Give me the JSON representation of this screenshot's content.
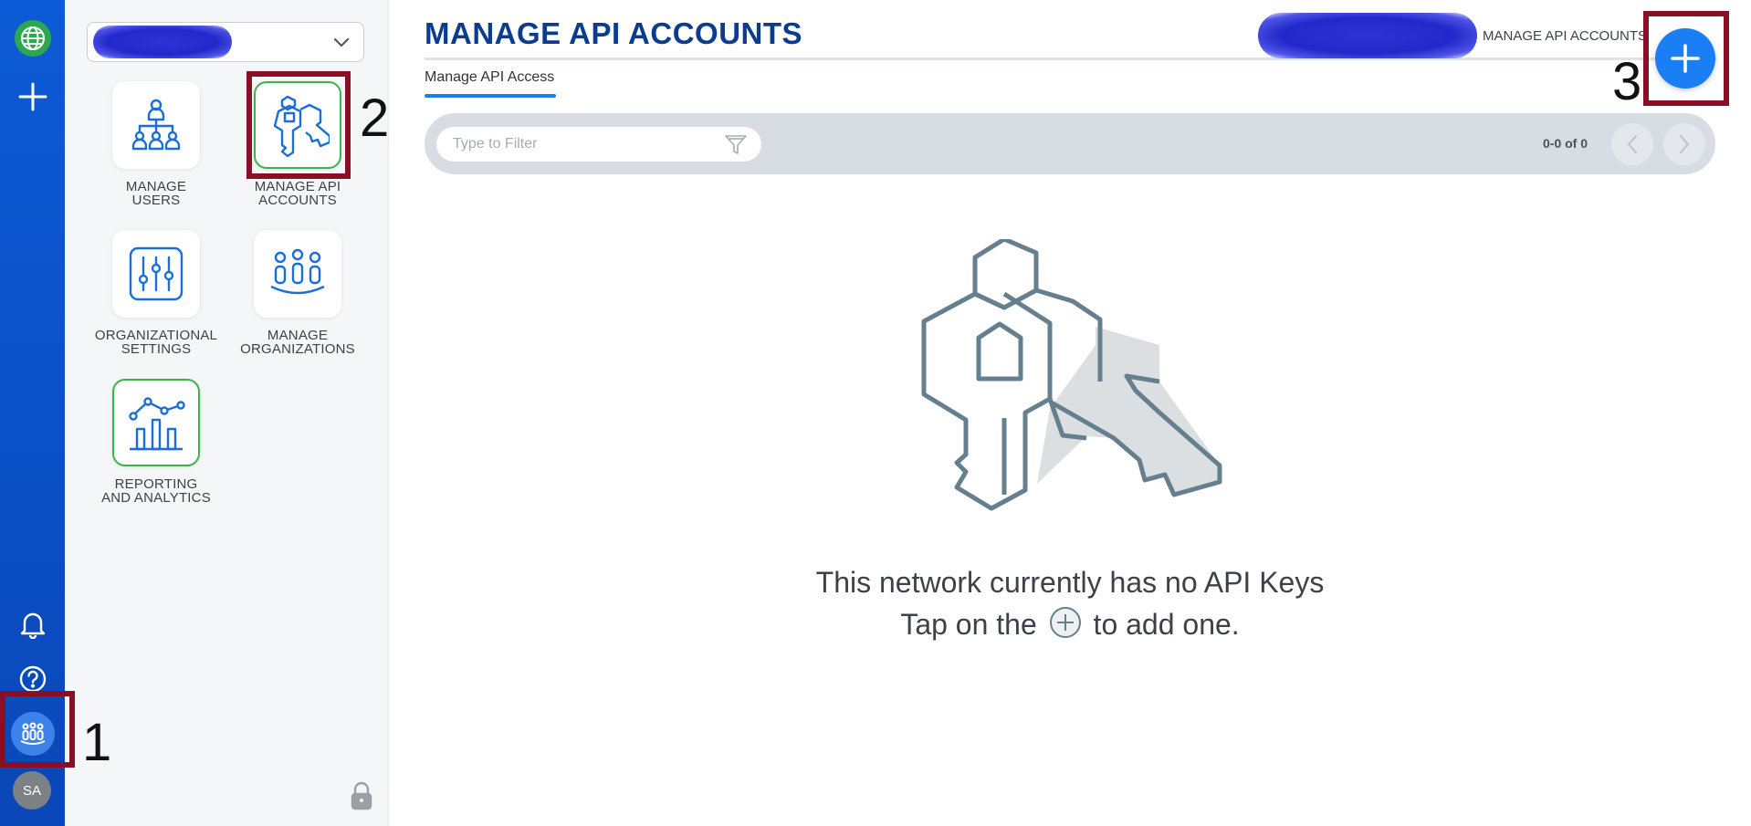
{
  "rail": {
    "avatar_initials": "SA"
  },
  "panel": {
    "tiles": [
      {
        "label": "MANAGE\nUSERS"
      },
      {
        "label": "MANAGE API\nACCOUNTS"
      },
      {
        "label": "ORGANIZATIONAL\nSETTINGS"
      },
      {
        "label": "MANAGE\nORGANIZATIONS"
      },
      {
        "label": "REPORTING\nAND ANALYTICS"
      }
    ]
  },
  "header": {
    "title": "MANAGE API ACCOUNTS",
    "breadcrumb": "MANAGE API ACCOUNTS"
  },
  "tabs": [
    {
      "label": "Manage API Access",
      "active": true
    }
  ],
  "filter": {
    "placeholder": "Type to Filter",
    "value": ""
  },
  "pager": {
    "count": "0-0 of 0"
  },
  "empty_state": {
    "line1": "This network currently has no API Keys",
    "line2_before": "Tap on the",
    "line2_after": "to add one."
  },
  "annotations": {
    "step1": "1",
    "step2": "2",
    "step3": "3"
  },
  "colors": {
    "rail": "#0d5bd6",
    "accent": "#1a7ef5",
    "title": "#0b3d8c",
    "highlight": "#8a0e24",
    "green": "#39b54a"
  },
  "icons": [
    "globe-icon",
    "plus-icon",
    "bell-icon",
    "help-icon",
    "organization-icon",
    "chevron-down-icon",
    "lock-icon",
    "filter-icon",
    "chevron-left-icon",
    "chevron-right-icon",
    "keys-icon"
  ]
}
